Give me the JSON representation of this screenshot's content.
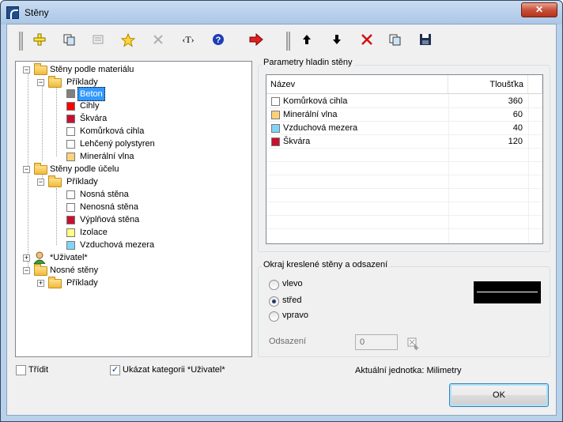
{
  "window": {
    "title": "Stěny",
    "close_label": "✕"
  },
  "toolbar": {
    "buttons": [
      {
        "name": "new-icon",
        "glyph": "✚"
      },
      {
        "name": "copy-icon",
        "glyph": "⧉"
      },
      {
        "name": "properties-icon",
        "glyph": "▤"
      },
      {
        "name": "favorite-star-icon",
        "glyph": "★"
      },
      {
        "name": "delete-disabled-icon",
        "glyph": "✕"
      },
      {
        "name": "text-icon",
        "glyph": "‹T›"
      },
      {
        "name": "help-icon",
        "glyph": "?"
      },
      {
        "name": "transfer-arrow-icon",
        "glyph": "➔"
      },
      {
        "name": "move-up-icon",
        "glyph": "↑"
      },
      {
        "name": "move-down-icon",
        "glyph": "↓"
      },
      {
        "name": "delete-layer-icon",
        "glyph": "✕"
      },
      {
        "name": "copy-layer-icon",
        "glyph": "⧉"
      },
      {
        "name": "save-icon",
        "glyph": "▣"
      }
    ]
  },
  "tree": {
    "nodes": [
      {
        "label": "Stěny podle materiálu"
      },
      {
        "label": "Příklady"
      },
      {
        "label": "Beton",
        "color": "#808080"
      },
      {
        "label": "Cihly",
        "color": "#ff0000"
      },
      {
        "label": "Škvára",
        "color": "#c8102e"
      },
      {
        "label": "Komůrková cihla",
        "color": "#ffffff"
      },
      {
        "label": "Lehčený polystyren",
        "color": "#ffffff"
      },
      {
        "label": "Minerální vlna",
        "color": "#ffd27a"
      },
      {
        "label": "Stěny podle účelu"
      },
      {
        "label": "Příklady"
      },
      {
        "label": "Nosná stěna",
        "color": "#ffffff"
      },
      {
        "label": "Nenosná stěna",
        "color": "#ffffff"
      },
      {
        "label": "Výplňová stěna",
        "color": "#c8102e"
      },
      {
        "label": "Izolace",
        "color": "#ffff80"
      },
      {
        "label": "Vzduchová mezera",
        "color": "#80d4f5"
      },
      {
        "label": "*Uživatel*"
      },
      {
        "label": "Nosné stěny"
      },
      {
        "label": "Příklady"
      }
    ]
  },
  "layers": {
    "group_label": "Parametry hladin stěny",
    "col_name": "Název",
    "col_thickness": "Tloušťka",
    "rows": [
      {
        "name": "Komůrková cihla",
        "thickness": "360",
        "color": "#ffffff"
      },
      {
        "name": "Minerální vlna",
        "thickness": "60",
        "color": "#ffd27a"
      },
      {
        "name": "Vzduchová mezera",
        "thickness": "40",
        "color": "#80d4f5"
      },
      {
        "name": "Škvára",
        "thickness": "120",
        "color": "#c8102e"
      }
    ]
  },
  "edge": {
    "group_label": "Okraj kreslené stěny a odsazení",
    "options": [
      "vlevo",
      "střed",
      "vpravo"
    ],
    "selected": "střed",
    "offset_label": "Odsazení",
    "offset_value": "0"
  },
  "footer": {
    "sort_label": "Třídit",
    "show_user_label": "Ukázat kategorii *Uživatel*",
    "unit_text": "Aktuální jednotka: Milimetry",
    "ok_label": "OK"
  }
}
